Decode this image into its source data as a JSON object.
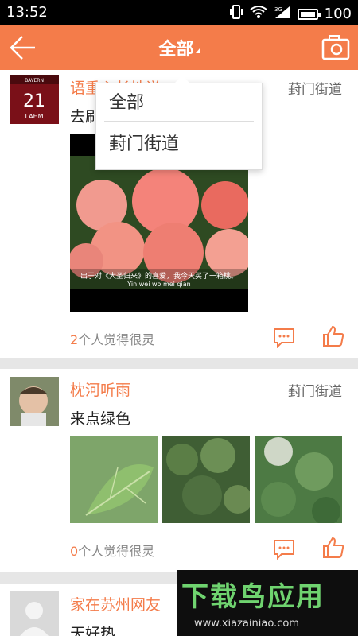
{
  "status": {
    "time": "13:52",
    "signal_label": "3G",
    "battery": "100"
  },
  "header": {
    "title": "全部"
  },
  "dropdown": {
    "options": [
      "全部",
      "葑门街道"
    ]
  },
  "posts": [
    {
      "username": "语重心长地说",
      "location": "葑门街道",
      "content": "去刷啊",
      "video_caption": "出于对《大圣归来》的喜爱，我今天买了一箱桃。",
      "video_sub": "Yin wei wo mei qian",
      "likes_num": "2",
      "likes_text": "个人觉得很灵"
    },
    {
      "username": "枕河听雨",
      "location": "葑门街道",
      "content": "来点绿色",
      "likes_num": "0",
      "likes_text": "个人觉得很灵"
    },
    {
      "username": "家在苏州网友",
      "content": "天好热"
    }
  ],
  "watermark": {
    "title": "下载鸟应用",
    "url": "www.xiazainiao.com"
  },
  "colors": {
    "accent": "#f47c4a"
  }
}
